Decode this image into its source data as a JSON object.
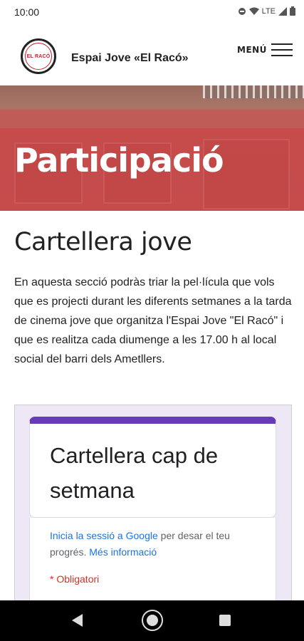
{
  "status_bar": {
    "time": "10:00",
    "network": "LTE"
  },
  "header": {
    "logo_text": "EL RACÓ",
    "site_title": "Espai Jove «El Racó»",
    "menu_label": "MENÚ"
  },
  "hero": {
    "title": "Participació"
  },
  "main": {
    "section_title": "Cartellera jove",
    "paragraph": "En aquesta secció podràs triar la pel·lícula que vols que es projecti durant les diferents setmanes a la tarda de cinema jove que organitza l'Espai Jove \"El Racó\" i que es realitza cada diumenge a les 17.00 h al local social del barri dels Ametllers."
  },
  "form": {
    "title": "Cartellera cap de setmana",
    "signin_link": "Inicia la sessió a Google",
    "signin_text": " per desar el teu progrés. ",
    "more_info_link": "Més informació",
    "required_note": "* Obligatori",
    "accent_color": "#673ab7"
  },
  "nav_bar": {
    "icons": [
      "back-icon",
      "home-icon",
      "recents-icon"
    ]
  }
}
